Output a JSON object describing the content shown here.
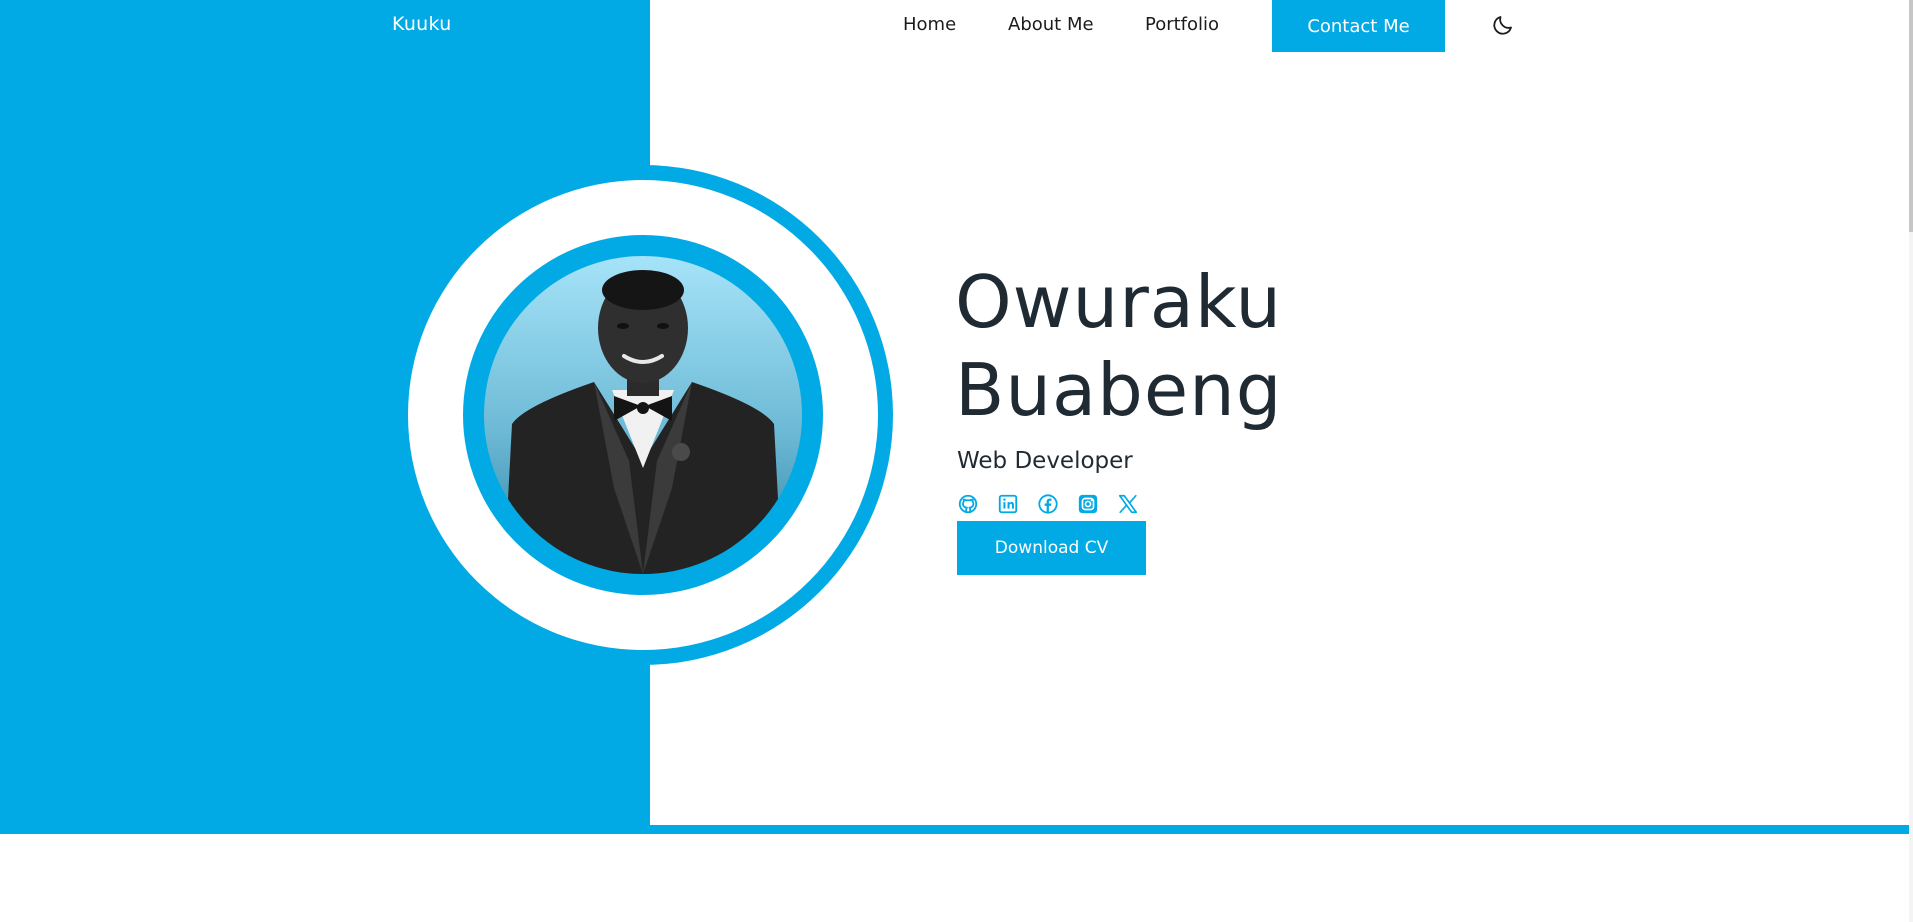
{
  "brand": {
    "logo_text": "Kuuku",
    "accent_color": "#02aae5",
    "text_color": "#1f2a33"
  },
  "nav": {
    "items": [
      {
        "label": "Home"
      },
      {
        "label": "About Me"
      },
      {
        "label": "Portfolio"
      }
    ],
    "contact_label": "Contact Me",
    "theme_toggle_icon": "moon-icon"
  },
  "hero": {
    "first_name": "Owuraku",
    "last_name": "Buabeng",
    "role": "Web Developer",
    "socials": [
      {
        "icon": "github-icon"
      },
      {
        "icon": "linkedin-icon"
      },
      {
        "icon": "facebook-icon"
      },
      {
        "icon": "instagram-icon"
      },
      {
        "icon": "x-icon"
      }
    ],
    "cv_label": "Download CV"
  }
}
